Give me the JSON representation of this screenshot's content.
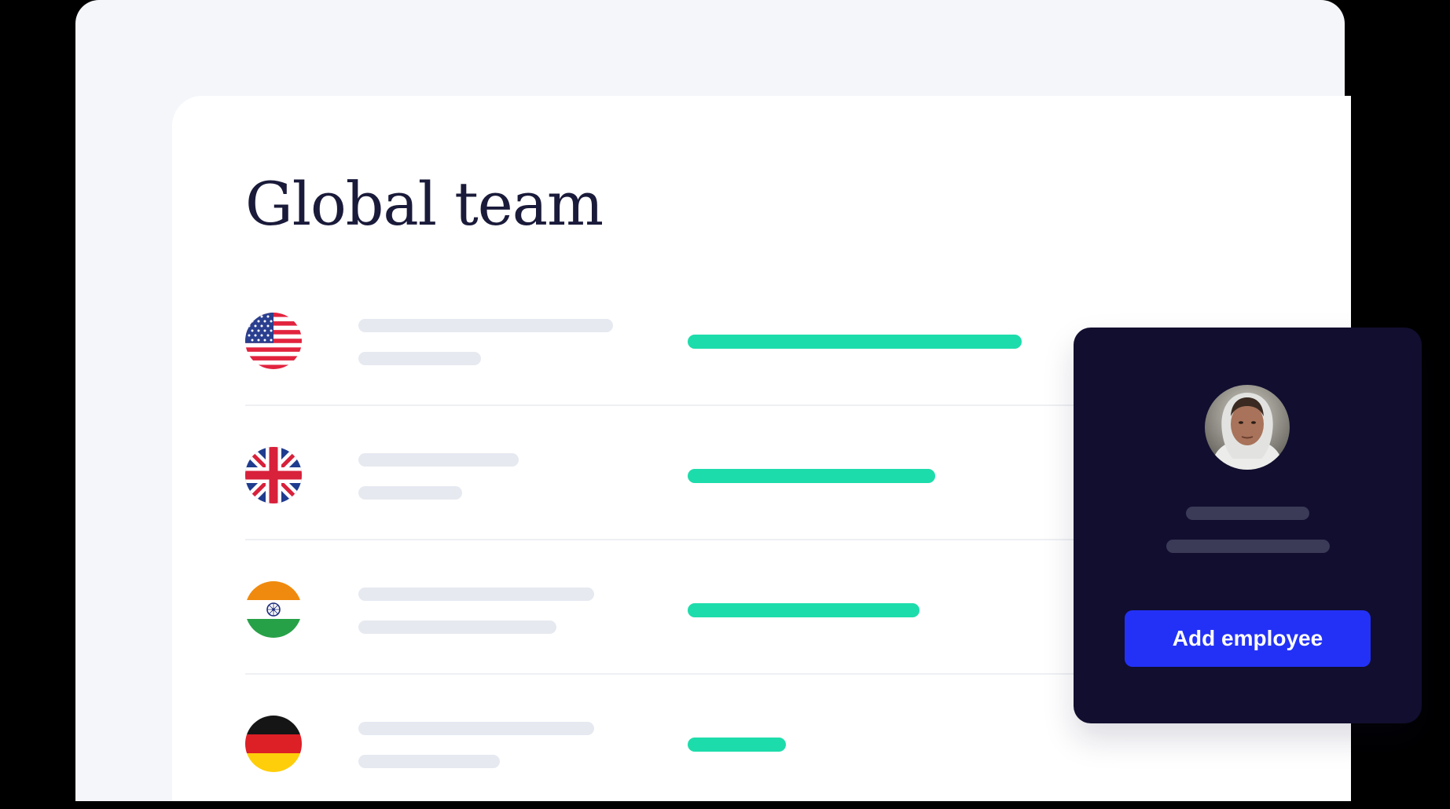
{
  "page": {
    "title": "Global team"
  },
  "team_rows": [
    {
      "country": "United States",
      "flag_icon": "us-flag-icon",
      "progress": 0.85
    },
    {
      "country": "United Kingdom",
      "flag_icon": "uk-flag-icon",
      "progress": 0.63
    },
    {
      "country": "India",
      "flag_icon": "india-flag-icon",
      "progress": 0.59
    },
    {
      "country": "Germany",
      "flag_icon": "germany-flag-icon",
      "progress": 0.25
    }
  ],
  "employee_card": {
    "add_button_label": "Add employee"
  },
  "colors": {
    "progress": "#1ddcab",
    "card_background": "#110e2f",
    "button": "#2331f6",
    "title": "#1a1a3a",
    "placeholder": "#e6e9f0"
  }
}
